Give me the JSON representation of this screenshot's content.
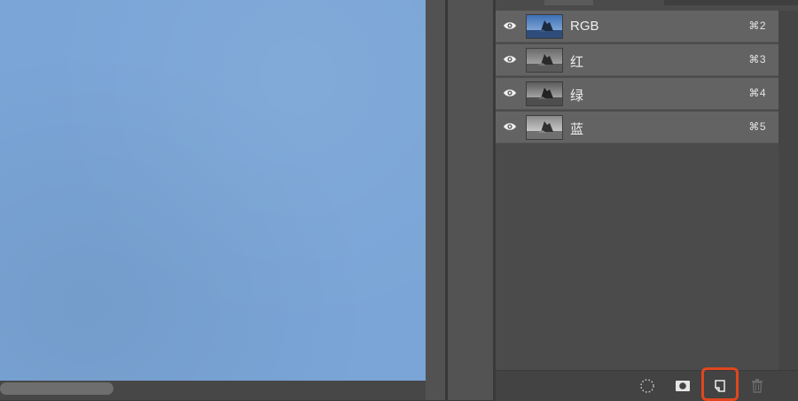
{
  "canvas": {
    "fill_color": "#7aa5d6"
  },
  "channels_panel": {
    "channels": [
      {
        "name": "RGB",
        "shortcut": "⌘2",
        "thumb_style": "color"
      },
      {
        "name": "红",
        "shortcut": "⌘3",
        "thumb_style": "gray-light"
      },
      {
        "name": "绿",
        "shortcut": "⌘4",
        "thumb_style": "gray-mid"
      },
      {
        "name": "蓝",
        "shortcut": "⌘5",
        "thumb_style": "gray-dark"
      }
    ],
    "footer_buttons": [
      {
        "icon": "dotted-circle-icon",
        "action": "load-channel-as-selection"
      },
      {
        "icon": "mask-icon",
        "action": "save-selection-as-channel"
      },
      {
        "icon": "new-channel-icon",
        "action": "create-new-channel",
        "highlighted": true
      },
      {
        "icon": "trash-icon",
        "action": "delete-channel",
        "disabled": true
      }
    ],
    "highlight_color": "#e0471e"
  }
}
